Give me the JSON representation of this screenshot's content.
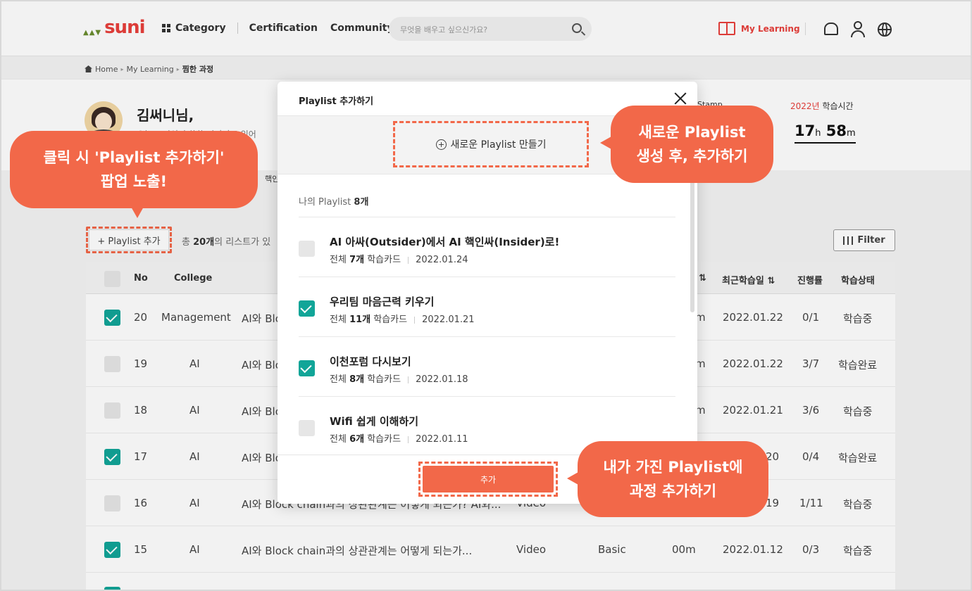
{
  "header": {
    "logo": "suni",
    "nav": [
      "Category",
      "Certification",
      "Community"
    ],
    "search_placeholder": "무엇을 배우고 싶으신가요?",
    "my_learning": "My Learning"
  },
  "breadcrumb": [
    "Home",
    "My Learning",
    "찜한 과정"
  ],
  "profile": {
    "name": "김써니님,",
    "greeting": "오늘도 지식이 쑥쑥 자라나고 있어",
    "stamp_label": "Stamp",
    "year": "2022년",
    "study_time_label": "학습시간",
    "hours": "17",
    "h_unit": "h",
    "minutes": "58",
    "m_unit": "m",
    "tab_fragment": "핵인"
  },
  "list": {
    "add_button": "+ Playlist 추가",
    "total_prefix": "총",
    "total_count": "20개",
    "total_suffix": "의 리스트가 있",
    "filter": "Filter"
  },
  "table": {
    "headers": {
      "no": "No",
      "college": "College",
      "recent": "최근학습일",
      "progress": "진행률",
      "status": "학습상태"
    },
    "rows": [
      {
        "checked": true,
        "no": "20",
        "college": "Management",
        "title": "AI와 Blo",
        "time": "m",
        "date": "2022.01.22",
        "progress": "0/1",
        "status": "학습중"
      },
      {
        "checked": false,
        "no": "19",
        "college": "AI",
        "title": "AI와 Blo",
        "time": "m",
        "date": "2022.01.22",
        "progress": "3/7",
        "status": "학습완료"
      },
      {
        "checked": false,
        "no": "18",
        "college": "AI",
        "title": "AI와 Blo",
        "time": "m",
        "date": "2022.01.21",
        "progress": "3/6",
        "status": "학습중"
      },
      {
        "checked": true,
        "no": "17",
        "college": "AI",
        "title": "AI와 Blo",
        "time": "20",
        "date": "",
        "progress": "0/4",
        "status": "학습완료"
      },
      {
        "checked": false,
        "no": "16",
        "college": "AI",
        "title": "AI와 Block chain과의 상관관계는 어떻게 되는가? AI와...",
        "type": "Video",
        "time": "19",
        "date": "",
        "progress": "1/11",
        "status": "학습중"
      },
      {
        "checked": true,
        "no": "15",
        "college": "AI",
        "title": "AI와 Block chain과의 상관관계는 어떻게 되는가...",
        "type": "Video",
        "level": "Basic",
        "time": "00m",
        "date": "2022.01.12",
        "progress": "0/3",
        "status": "학습중"
      }
    ]
  },
  "modal": {
    "title": "Playlist 추가하기",
    "new_playlist": "새로운 Playlist 만들기",
    "count_prefix": "나의 Playlist",
    "count": "8개",
    "playlists": [
      {
        "checked": false,
        "title": "AI 아싸(Outsider)에서 AI 핵인싸(Insider)로!",
        "prefix": "전체",
        "cards": "7개",
        "suffix": "학습카드",
        "date": "2022.01.24"
      },
      {
        "checked": true,
        "title": "우리팀 마음근력 키우기",
        "prefix": "전체",
        "cards": "11개",
        "suffix": "학습카드",
        "date": "2022.01.21"
      },
      {
        "checked": true,
        "title": "이천포럼 다시보기",
        "prefix": "전체",
        "cards": "8개",
        "suffix": "학습카드",
        "date": "2022.01.18"
      },
      {
        "checked": false,
        "title": "Wifi 쉽게 이해하기",
        "prefix": "전체",
        "cards": "6개",
        "suffix": "학습카드",
        "date": "2022.01.11"
      }
    ],
    "add_button": "추가"
  },
  "callouts": {
    "left_line1": "클릭 시 'Playlist 추가하기'",
    "left_line2": "팝업 노출!",
    "right_top_line1": "새로운 Playlist",
    "right_top_line2": "생성 후, 추가하기",
    "right_bottom_line1": "내가 가진 Playlist에",
    "right_bottom_line2": "과정 추가하기"
  },
  "colors": {
    "accent": "#f26849",
    "brand": "#e8403b",
    "check": "#11a598"
  }
}
